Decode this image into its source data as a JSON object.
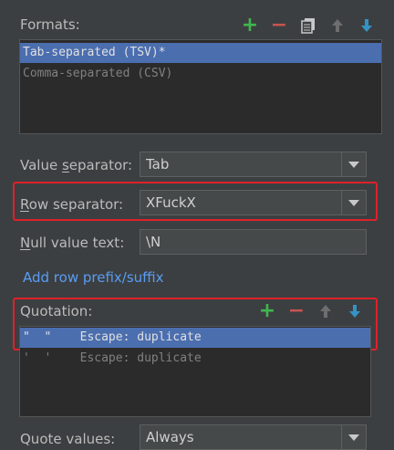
{
  "formats": {
    "label": "Formats:",
    "items": [
      {
        "text": "Tab-separated (TSV)*",
        "selected": true
      },
      {
        "text": "Comma-separated (CSV)",
        "selected": false
      }
    ]
  },
  "value_separator": {
    "label_pre": "Value ",
    "label_mnemonic": "s",
    "label_post": "eparator:",
    "value": "Tab"
  },
  "row_separator": {
    "label_pre": "",
    "label_mnemonic": "R",
    "label_post": "ow separator:",
    "value": "XFuckX"
  },
  "null_value": {
    "label_pre": "",
    "label_mnemonic": "N",
    "label_post": "ull value text:",
    "value": "\\N"
  },
  "add_prefix_link": "Add row prefix/suffix",
  "quotation": {
    "label": "Quotation:",
    "items": [
      {
        "quote": "\"  \"",
        "escape": "Escape: duplicate",
        "selected": true
      },
      {
        "quote": "'  '",
        "escape": "Escape: duplicate",
        "selected": false
      }
    ]
  },
  "quote_values": {
    "label": "Quote values:",
    "value": "Always"
  },
  "colors": {
    "accent_add": "#3fb74e",
    "accent_remove": "#c75450",
    "selection": "#4b6eaf",
    "highlight_box": "#e0202a",
    "link": "#589df6"
  }
}
